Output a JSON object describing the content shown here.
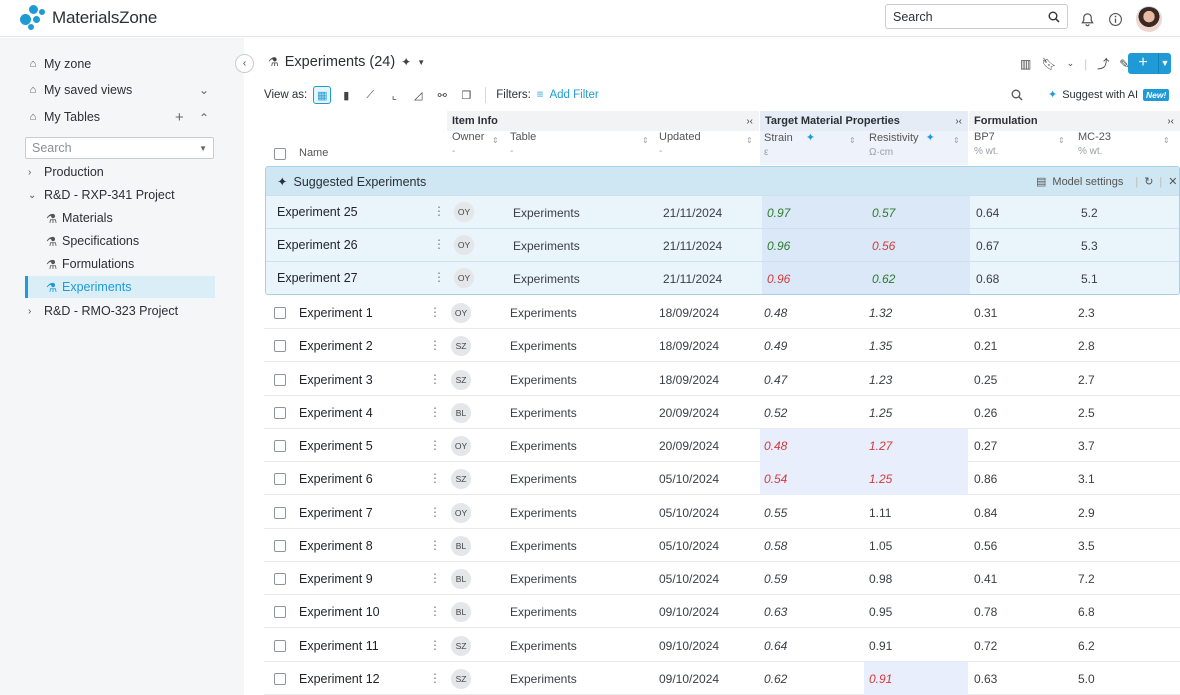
{
  "app": {
    "name": "MaterialsZone"
  },
  "topbar": {
    "search_placeholder": "Search",
    "avatar_alt": ""
  },
  "sidebar": {
    "my_zone": "My zone",
    "saved_views": "My saved views",
    "my_tables": "My Tables",
    "search_placeholder": "Search",
    "tree": [
      {
        "label": "Production",
        "level": 0,
        "expanded": false
      },
      {
        "label": "R&D - RXP-341 Project",
        "level": 0,
        "expanded": true
      },
      {
        "label": "Materials",
        "level": 1
      },
      {
        "label": "Specifications",
        "level": 1
      },
      {
        "label": "Formulations",
        "level": 1
      },
      {
        "label": "Experiments",
        "level": 1,
        "active": true
      },
      {
        "label": "R&D - RMO-323 Project",
        "level": 0,
        "expanded": false
      }
    ]
  },
  "header": {
    "title": "Experiments (24)"
  },
  "toolbar": {
    "view_as": "View as:",
    "filters": "Filters:",
    "add_filter": "Add Filter",
    "suggest_ai": "Suggest with AI",
    "new_badge": "New!"
  },
  "table": {
    "groups": {
      "item_info": "Item Info",
      "target": "Target Material Properties",
      "formulation": "Formulation"
    },
    "columns": {
      "name": "Name",
      "owner": "Owner",
      "owner_unit": "-",
      "table": "Table",
      "table_unit": "-",
      "updated": "Updated",
      "updated_unit": "-",
      "strain": "Strain",
      "strain_unit": "ε",
      "resistivity": "Resistivity",
      "resistivity_unit": "Ω·cm",
      "bp7": "BP7",
      "bp7_unit": "% wt.",
      "mc23": "MC-23",
      "mc23_unit": "% wt."
    },
    "suggested": {
      "title": "Suggested Experiments",
      "model_settings": "Model settings",
      "rows": [
        {
          "name": "Experiment 25",
          "owner": "OY",
          "table": "Experiments",
          "updated": "21/11/2024",
          "strain": "0.97",
          "strain_state": "green",
          "resistivity": "0.57",
          "res_state": "green",
          "bp7": "0.64",
          "mc23": "5.2"
        },
        {
          "name": "Experiment 26",
          "owner": "OY",
          "table": "Experiments",
          "updated": "21/11/2024",
          "strain": "0.96",
          "strain_state": "green",
          "resistivity": "0.56",
          "res_state": "red",
          "bp7": "0.67",
          "mc23": "5.3"
        },
        {
          "name": "Experiment 27",
          "owner": "OY",
          "table": "Experiments",
          "updated": "21/11/2024",
          "strain": "0.96",
          "strain_state": "red",
          "resistivity": "0.62",
          "res_state": "green",
          "bp7": "0.68",
          "mc23": "5.1"
        }
      ]
    },
    "rows": [
      {
        "name": "Experiment 1",
        "owner": "OY",
        "table": "Experiments",
        "updated": "18/09/2024",
        "strain": "0.48",
        "strain_state": "normal",
        "resistivity": "1.32",
        "res_state": "normal",
        "bp7": "0.31",
        "mc23": "2.3"
      },
      {
        "name": "Experiment 2",
        "owner": "SZ",
        "table": "Experiments",
        "updated": "18/09/2024",
        "strain": "0.49",
        "strain_state": "normal",
        "resistivity": "1.35",
        "res_state": "normal",
        "bp7": "0.21",
        "mc23": "2.8"
      },
      {
        "name": "Experiment 3",
        "owner": "SZ",
        "table": "Experiments",
        "updated": "18/09/2024",
        "strain": "0.47",
        "strain_state": "normal",
        "resistivity": "1.23",
        "res_state": "normal",
        "bp7": "0.25",
        "mc23": "2.7"
      },
      {
        "name": "Experiment 4",
        "owner": "BL",
        "table": "Experiments",
        "updated": "20/09/2024",
        "strain": "0.52",
        "strain_state": "normal",
        "resistivity": "1.25",
        "res_state": "normal",
        "bp7": "0.26",
        "mc23": "2.5"
      },
      {
        "name": "Experiment 5",
        "owner": "OY",
        "table": "Experiments",
        "updated": "20/09/2024",
        "strain": "0.48",
        "strain_state": "red",
        "resistivity": "1.27",
        "res_state": "red",
        "bp7": "0.27",
        "mc23": "3.7"
      },
      {
        "name": "Experiment 6",
        "owner": "SZ",
        "table": "Experiments",
        "updated": "05/10/2024",
        "strain": "0.54",
        "strain_state": "red",
        "resistivity": "1.25",
        "res_state": "red",
        "bp7": "0.86",
        "mc23": "3.1"
      },
      {
        "name": "Experiment 7",
        "owner": "OY",
        "table": "Experiments",
        "updated": "05/10/2024",
        "strain": "0.55",
        "strain_state": "normal",
        "resistivity": "1.11",
        "res_state": "plain",
        "bp7": "0.84",
        "mc23": "2.9"
      },
      {
        "name": "Experiment 8",
        "owner": "BL",
        "table": "Experiments",
        "updated": "05/10/2024",
        "strain": "0.58",
        "strain_state": "normal",
        "resistivity": "1.05",
        "res_state": "plain",
        "bp7": "0.56",
        "mc23": "3.5"
      },
      {
        "name": "Experiment 9",
        "owner": "BL",
        "table": "Experiments",
        "updated": "05/10/2024",
        "strain": "0.59",
        "strain_state": "normal",
        "resistivity": "0.98",
        "res_state": "plain",
        "bp7": "0.41",
        "mc23": "7.2"
      },
      {
        "name": "Experiment 10",
        "owner": "BL",
        "table": "Experiments",
        "updated": "09/10/2024",
        "strain": "0.63",
        "strain_state": "normal",
        "resistivity": "0.95",
        "res_state": "plain",
        "bp7": "0.78",
        "mc23": "6.8"
      },
      {
        "name": "Experiment 11",
        "owner": "SZ",
        "table": "Experiments",
        "updated": "09/10/2024",
        "strain": "0.64",
        "strain_state": "normal",
        "resistivity": "0.91",
        "res_state": "plain",
        "bp7": "0.72",
        "mc23": "6.2"
      },
      {
        "name": "Experiment 12",
        "owner": "SZ",
        "table": "Experiments",
        "updated": "09/10/2024",
        "strain": "0.62",
        "strain_state": "normal",
        "resistivity": "0.91",
        "res_state": "red",
        "bp7": "0.63",
        "mc23": "5.0"
      }
    ]
  },
  "colors": {
    "accent": "#1e9bd7",
    "red": "#d43a3a",
    "green": "#2d7a2d"
  }
}
